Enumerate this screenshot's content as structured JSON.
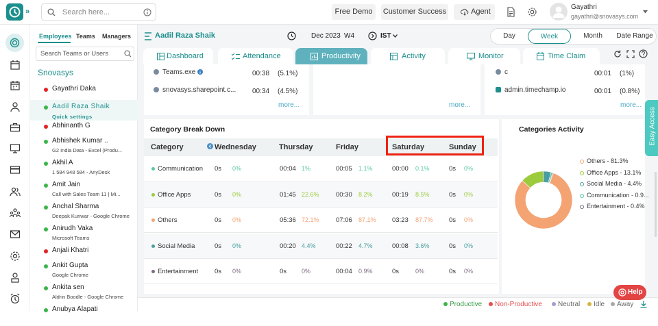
{
  "topbar": {
    "search_placeholder": "Search here...",
    "free_demo": "Free Demo",
    "customer_success": "Customer Success",
    "agent": "Agent",
    "user_name": "Gayathri",
    "user_email": "gayathri@snovasys.com"
  },
  "employees_panel": {
    "tabs": [
      "Employees",
      "Teams",
      "Managers"
    ],
    "search_placeholder": "Search Teams or Users",
    "org": "Snovasys",
    "list": [
      {
        "name": "Gayathri Daka",
        "sub": "",
        "status": "#e02424"
      },
      {
        "name": "Aadil Raza Shaik",
        "sub": "Quick settings",
        "status": "#3bb54a"
      },
      {
        "name": "Abhinanth G",
        "sub": "",
        "status": "#e02424"
      },
      {
        "name": "Abhishek Kumar ..",
        "sub": "G2 India Data - Excel (Produ...",
        "status": "#3bb54a"
      },
      {
        "name": "Akhil A",
        "sub": "1 584 948 584 - AnyDesk",
        "status": "#3bb54a"
      },
      {
        "name": "Amit Jain",
        "sub": "Call with Sales Team 11 | Mi...",
        "status": "#3bb54a"
      },
      {
        "name": "Anchal Sharma",
        "sub": "Deepak Kunwar - Google Chrome",
        "status": "#3bb54a"
      },
      {
        "name": "Anirudh Vaka",
        "sub": "Microsoft Teams",
        "status": "#3bb54a"
      },
      {
        "name": "Anjali Khatri",
        "sub": "",
        "status": "#e02424"
      },
      {
        "name": "Ankit Gupta",
        "sub": "Google Chrome",
        "status": "#3bb54a"
      },
      {
        "name": "Ankita sen",
        "sub": "Aldrin Boodle - Google Chrome",
        "status": "#3bb54a"
      },
      {
        "name": "Anubya Alapati",
        "sub": "",
        "status": "#3bb54a"
      }
    ]
  },
  "header": {
    "employee_name": "Aadil Raza Shaik",
    "date": "Dec 2023",
    "week": "W4",
    "timezone": "IST",
    "periods": [
      "Day",
      "Week",
      "Month",
      "Date Range"
    ],
    "active_period": "Week"
  },
  "tabs": [
    "Dashboard",
    "Attendance",
    "Productivity",
    "Activity",
    "Monitor",
    "Time Claim"
  ],
  "active_tab": "Productivity",
  "top_apps": {
    "col1": [
      {
        "name": "Teams.exe",
        "time": "00:38",
        "pct": "(5.1%)"
      },
      {
        "name": "snovasys.sharepoint.c...",
        "time": "00:34",
        "pct": "(4.5%)"
      }
    ],
    "col3": [
      {
        "name": "c",
        "time": "00:01",
        "pct": "(1%)"
      },
      {
        "name": "admin.timechamp.io",
        "time": "00:01",
        "pct": "(0.8%)"
      }
    ],
    "more": "more..."
  },
  "category_breakdown": {
    "title": "Category Break Down",
    "headers": [
      "Category",
      "Wednesday",
      "Thursday",
      "Friday",
      "Saturday",
      "Sunday"
    ],
    "rows": [
      {
        "category": "Communication",
        "dot": "#5ac8a8",
        "wed": [
          "0s",
          "0%"
        ],
        "thu": [
          "00:04",
          "1%"
        ],
        "fri": [
          "00:05",
          "1.1%"
        ],
        "sat": [
          "00:00",
          "0.1%"
        ],
        "sun": [
          "0s",
          "0%"
        ]
      },
      {
        "category": "Office Apps",
        "dot": "#9ccc3d",
        "wed": [
          "0s",
          "0%"
        ],
        "thu": [
          "01:45",
          "22.6%"
        ],
        "fri": [
          "00:30",
          "8.2%"
        ],
        "sat": [
          "00:19",
          "8.5%"
        ],
        "sun": [
          "0s",
          "0%"
        ]
      },
      {
        "category": "Others",
        "dot": "#f4a373",
        "wed": [
          "0s",
          "0%"
        ],
        "thu": [
          "05:36",
          "72.1%"
        ],
        "fri": [
          "07:06",
          "87.1%"
        ],
        "sat": [
          "03:23",
          "87.7%"
        ],
        "sun": [
          "0s",
          "0%"
        ]
      },
      {
        "category": "Social Media",
        "dot": "#4a9ea0",
        "wed": [
          "0s",
          "0%"
        ],
        "thu": [
          "00:20",
          "4.4%"
        ],
        "fri": [
          "00:22",
          "4.7%"
        ],
        "sat": [
          "00:08",
          "3.6%"
        ],
        "sun": [
          "0s",
          "0%"
        ]
      },
      {
        "category": "Entertainment",
        "dot": "#7c6b82",
        "wed": [
          "0s",
          "0%"
        ],
        "thu": [
          "0s",
          "0%"
        ],
        "fri": [
          "00:04",
          "0.9%"
        ],
        "sat": [
          "0s",
          "0%"
        ],
        "sun": [
          "0s",
          "0%"
        ]
      }
    ]
  },
  "categories_activity": {
    "title": "Categories Activity",
    "legend": [
      {
        "label": "Others - 81.3%",
        "color": "#f4a373"
      },
      {
        "label": "Office Apps - 13.1%",
        "color": "#9ccc3d"
      },
      {
        "label": "Social Media - 4.4%",
        "color": "#4a9ea0"
      },
      {
        "label": "Communication - 0.9...",
        "color": "#5ac8a8"
      },
      {
        "label": "Entertainment - 0.4%",
        "color": "#7c6b82"
      }
    ],
    "slices": [
      81.3,
      13.1,
      4.4,
      0.9,
      0.4
    ]
  },
  "side": {
    "easy_access": "Easy Access",
    "help": "Help"
  },
  "footer": [
    {
      "label": "Productive",
      "color": "#3bb54a"
    },
    {
      "label": "Non-Productive",
      "color": "#e45050"
    },
    {
      "label": "Neutral",
      "color": "#a0a0d0"
    },
    {
      "label": "Idle",
      "color": "#d4b43a"
    },
    {
      "label": "Away",
      "color": "#a8a8a8"
    }
  ]
}
